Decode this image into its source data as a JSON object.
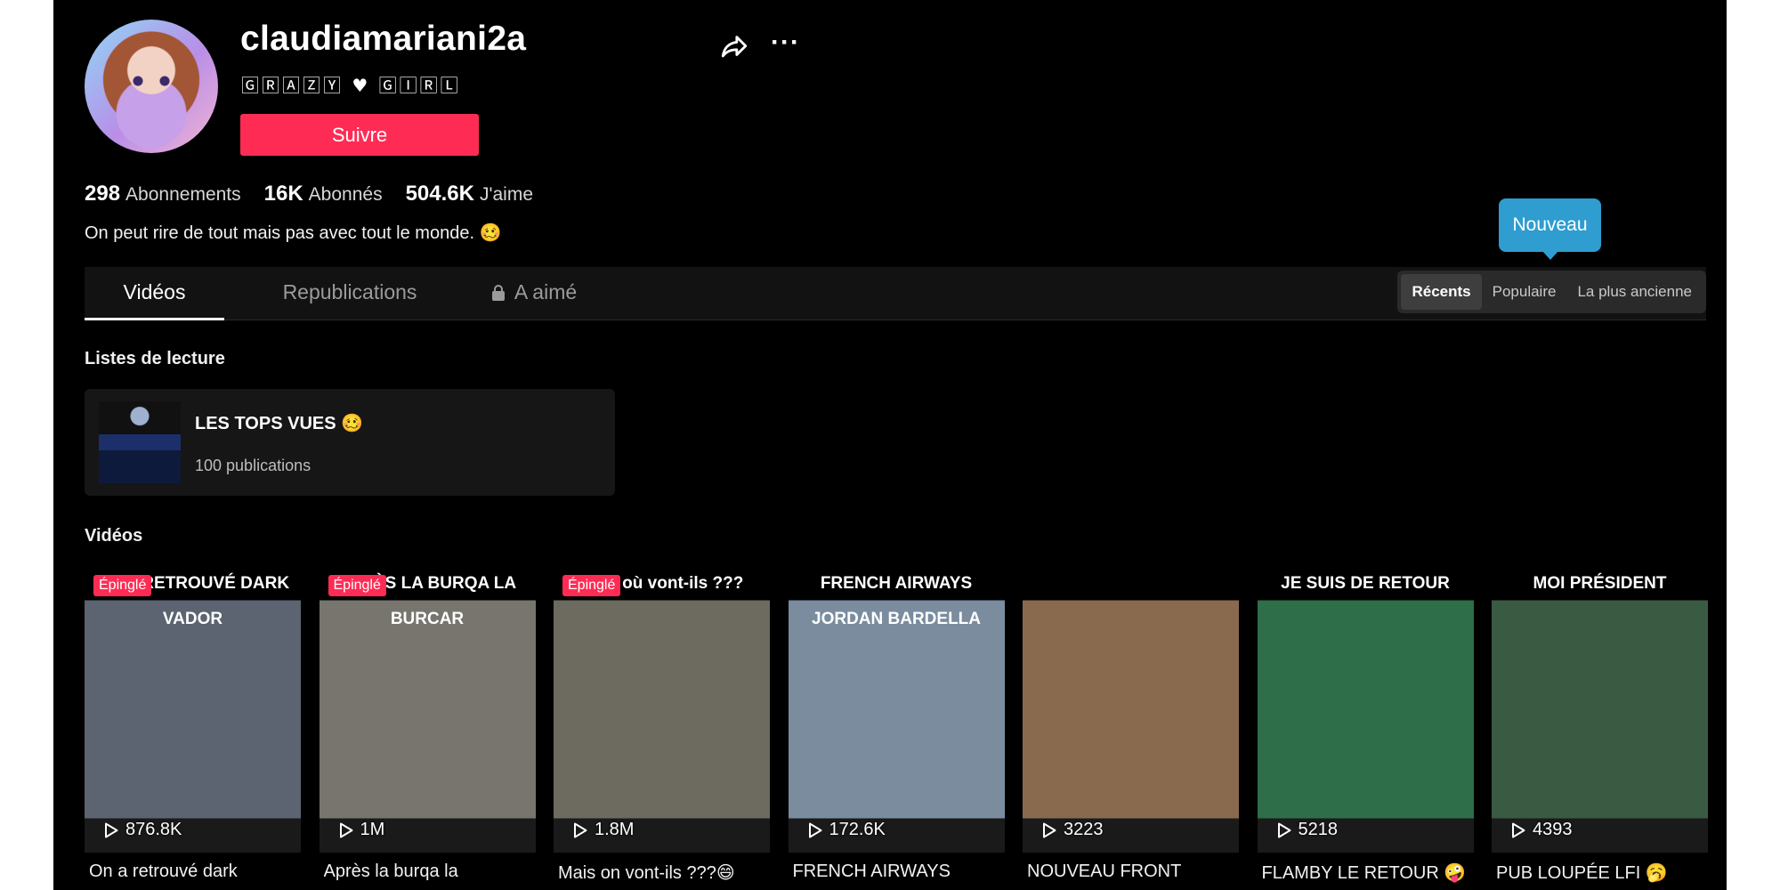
{
  "profile": {
    "username": "claudiamariani2a",
    "display_name": "🄶🅁🄰🅉🅈 ♥ 🄶🄸🅁🄻",
    "follow_label": "Suivre",
    "stats": [
      {
        "value": "298",
        "label": "Abonnements"
      },
      {
        "value": "16K",
        "label": "Abonnés"
      },
      {
        "value": "504.6K",
        "label": "J'aime"
      }
    ],
    "bio": "On peut rire de tout mais pas avec tout le monde. 🥴"
  },
  "tooltip": {
    "text": "Nouveau"
  },
  "tabs": [
    {
      "label": "Vidéos",
      "active": true
    },
    {
      "label": "Republications",
      "active": false
    },
    {
      "label": "A aimé",
      "active": false,
      "icon": "lock-icon"
    }
  ],
  "sort": [
    {
      "label": "Récents",
      "active": true
    },
    {
      "label": "Populaire",
      "active": false
    },
    {
      "label": "La plus ancienne",
      "active": false
    }
  ],
  "playlists": {
    "title": "Listes de lecture",
    "items": [
      {
        "title": "LES TOPS VUES 🥴",
        "count": "100 publications"
      }
    ]
  },
  "videos": {
    "title": "Vidéos",
    "items": [
      {
        "views": "876.8K",
        "caption": "On a retrouvé dark",
        "pinned": "Épinglé",
        "overlay": "ON A RETROUVÉ DARK VADOR",
        "color": "#5b6470"
      },
      {
        "views": "1M",
        "caption": "Après la burqa la",
        "pinned": "Épinglé",
        "overlay": "APRÈS LA BURQA LA BURCAR",
        "color": "#77756e"
      },
      {
        "views": "1.8M",
        "caption": "Mais on vont-ils ???😄",
        "pinned": "Épinglé",
        "overlay": "Mais où vont-ils ???",
        "color": "#6d6a60"
      },
      {
        "views": "172.6K",
        "caption": "FRENCH AIRWAYS",
        "pinned": "",
        "overlay": "FRENCH AIRWAYS JORDAN BARDELLA",
        "color": "#7a8c9e"
      },
      {
        "views": "3223",
        "caption": "NOUVEAU FRONT",
        "pinned": "",
        "overlay": "",
        "color": "#8a6a4e"
      },
      {
        "views": "5218",
        "caption": "FLAMBY LE RETOUR 🤪",
        "pinned": "",
        "overlay": "JE SUIS DE RETOUR",
        "color": "#2e6e48"
      },
      {
        "views": "4393",
        "caption": "PUB LOUPÉE LFI 🥱",
        "pinned": "",
        "overlay": "MOI PRÉSIDENT",
        "color": "#3b5a42"
      }
    ]
  }
}
